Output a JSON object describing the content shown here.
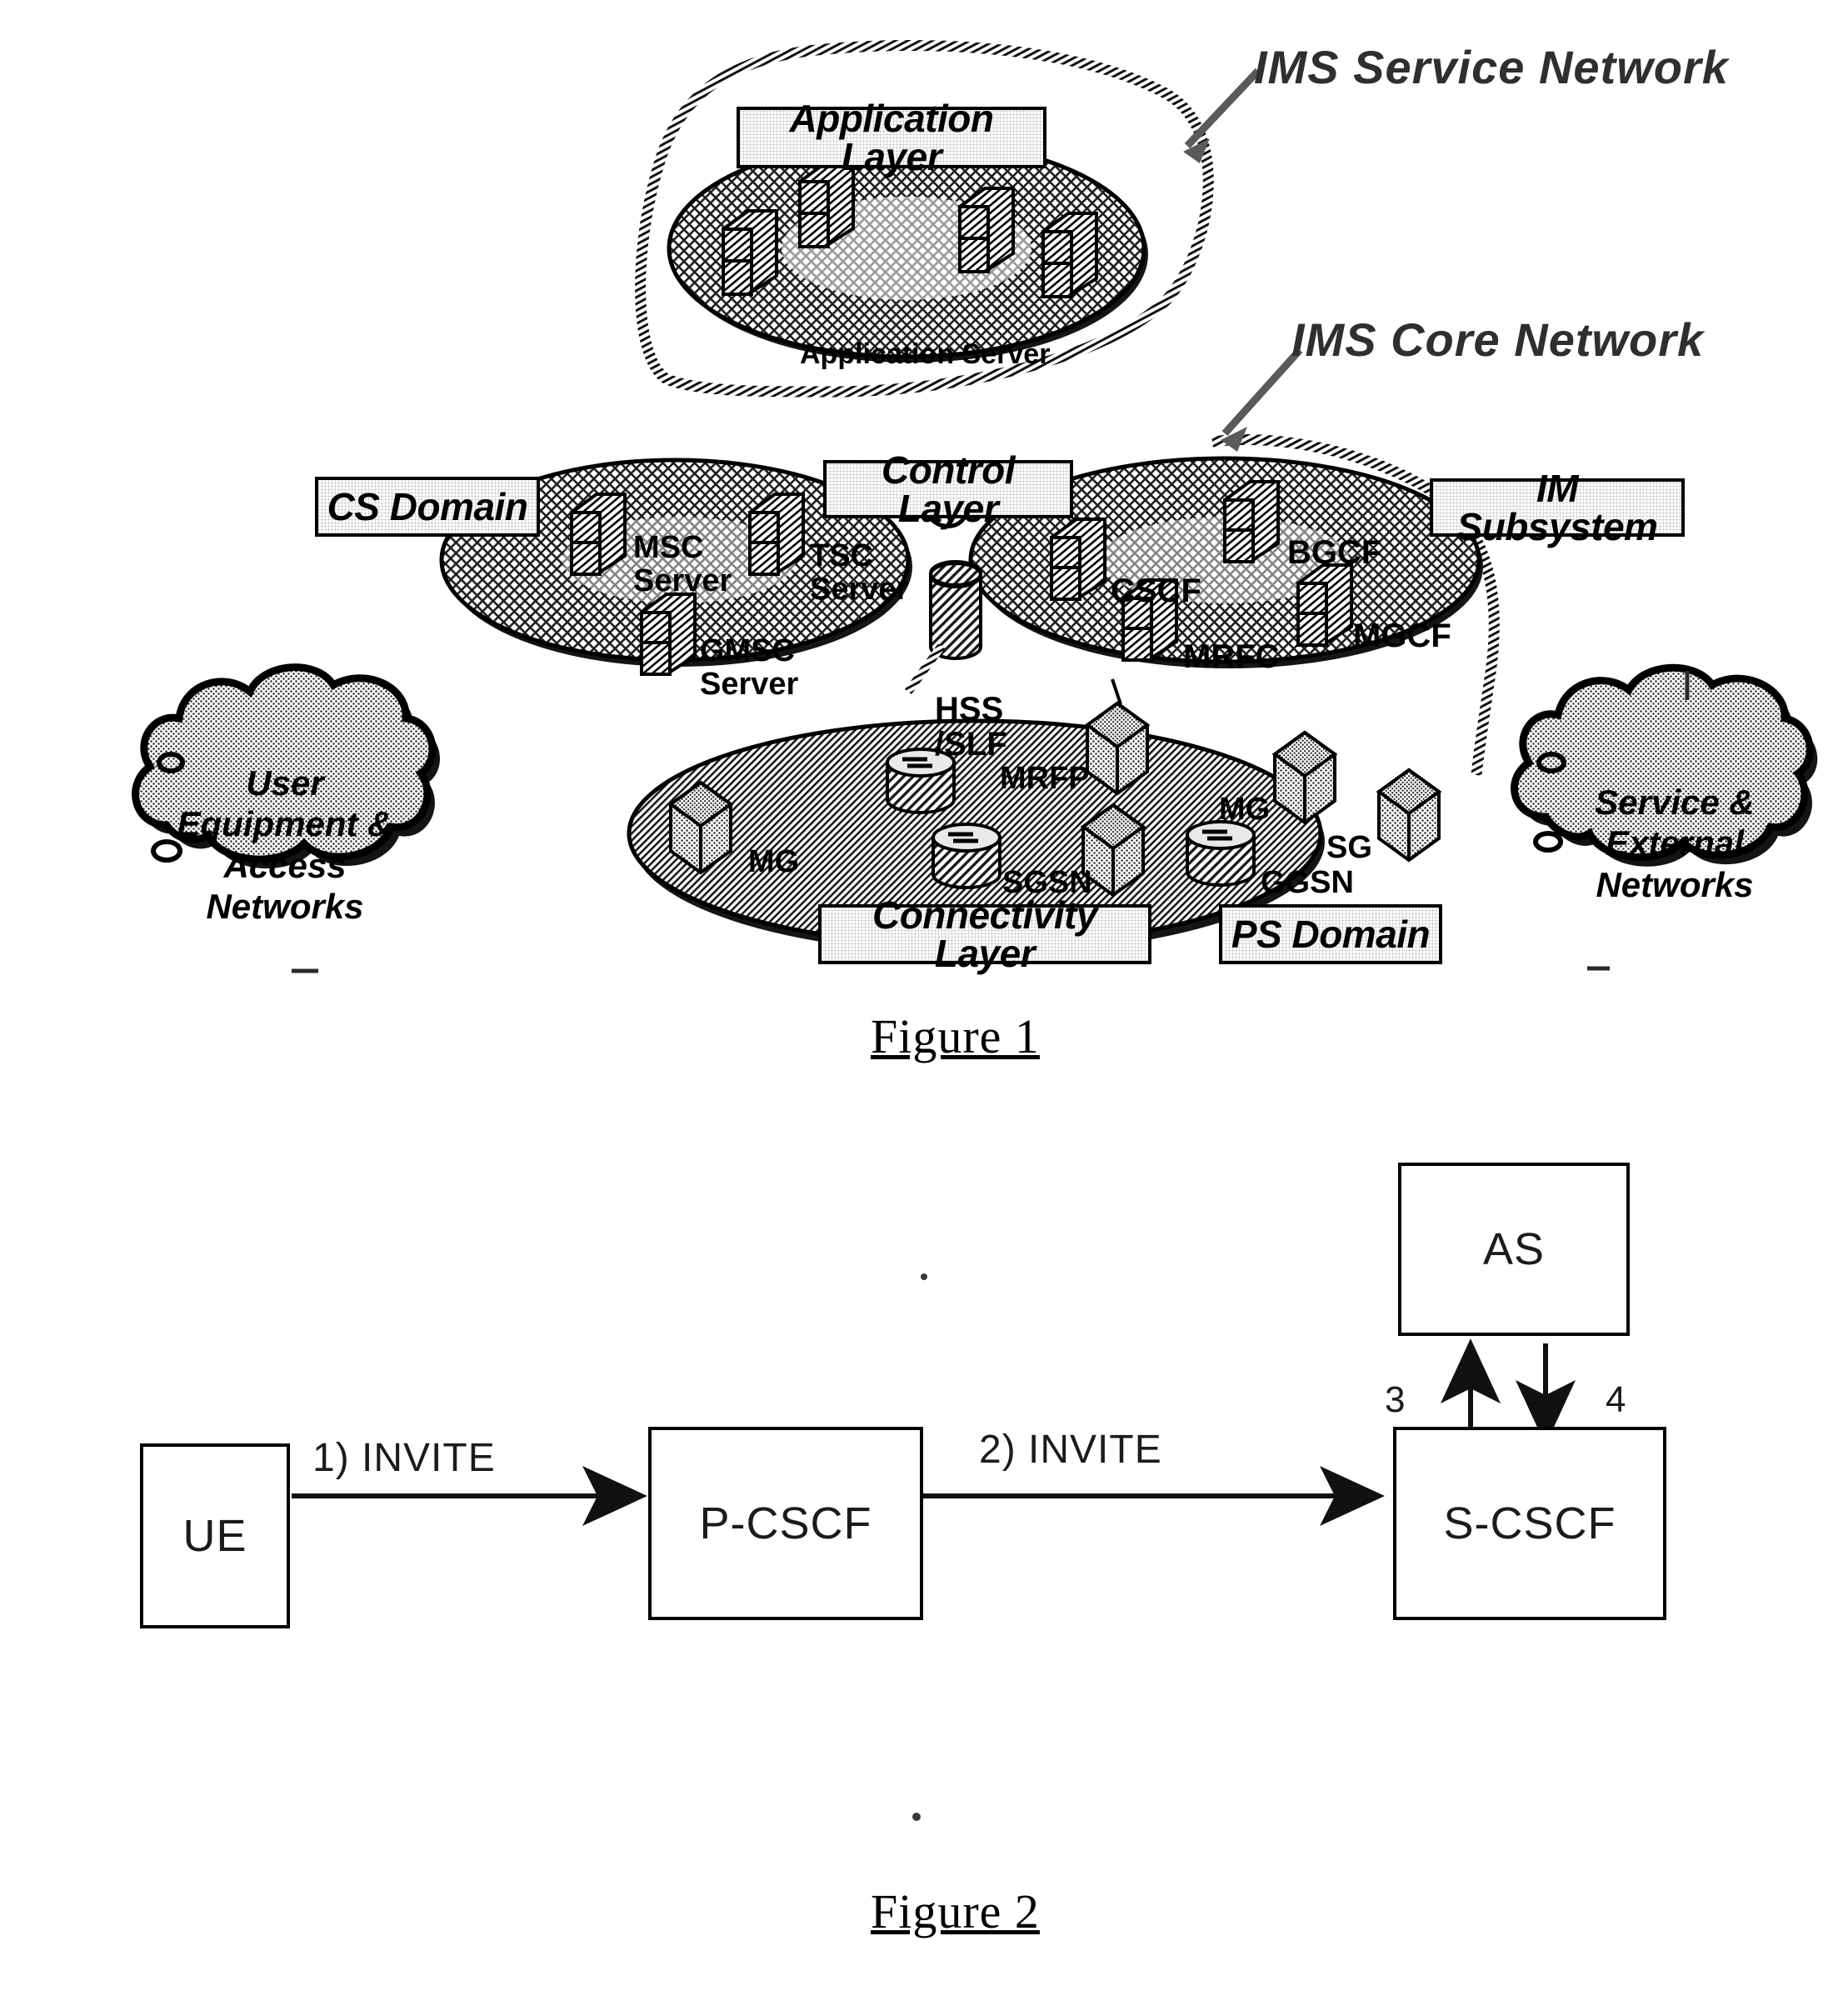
{
  "figure1": {
    "callouts": [
      {
        "id": "ims-service-network",
        "text": "IMS Service Network"
      },
      {
        "id": "ims-core-network",
        "text": "IMS Core Network"
      }
    ],
    "plates": [
      {
        "id": "application-layer",
        "text": "Application Layer"
      },
      {
        "id": "cs-domain",
        "text": "CS Domain"
      },
      {
        "id": "control-layer",
        "text": "Control Layer"
      },
      {
        "id": "im-subsystem",
        "text": "IM Subsystem"
      },
      {
        "id": "connectivity-layer",
        "text": "Connectivity Layer"
      },
      {
        "id": "ps-domain",
        "text": "PS Domain"
      }
    ],
    "application_layer": {
      "inner_label": "Application Server",
      "server_count": 4
    },
    "cs_domain_nodes": [
      {
        "id": "msc-server",
        "label": "MSC\nServer"
      },
      {
        "id": "tsc-server",
        "label": "TSC\nServer"
      },
      {
        "id": "gmsc-server",
        "label": "GMSC\nServer"
      }
    ],
    "im_subsystem_nodes": [
      {
        "id": "cscf",
        "label": "CSCF"
      },
      {
        "id": "bgcf",
        "label": "BGCF"
      },
      {
        "id": "mrfc",
        "label": "MRFC"
      },
      {
        "id": "mgcf",
        "label": "MGCF"
      }
    ],
    "hss_label": "HSS\n/SLF",
    "connectivity_nodes": [
      {
        "id": "mg-left",
        "label": "MG"
      },
      {
        "id": "mrfp",
        "label": "MRFP"
      },
      {
        "id": "sgsn",
        "label": "SGSN"
      },
      {
        "id": "mg-right",
        "label": "MG"
      },
      {
        "id": "sg",
        "label": "SG"
      },
      {
        "id": "ggsn",
        "label": "GGSN"
      }
    ],
    "clouds": [
      {
        "id": "user-equipment-access-networks",
        "label": "User\nEquipment &\nAccess\nNetworks"
      },
      {
        "id": "service-external-networks",
        "label": "Service &\nExternal\nNetworks"
      }
    ],
    "caption": "Figure 1"
  },
  "figure2": {
    "boxes": [
      {
        "id": "ue",
        "label": "UE"
      },
      {
        "id": "p-cscf",
        "label": "P-CSCF"
      },
      {
        "id": "s-cscf",
        "label": "S-CSCF"
      },
      {
        "id": "as",
        "label": "AS"
      }
    ],
    "flow_labels": [
      {
        "id": "step-1",
        "text": "1) INVITE"
      },
      {
        "id": "step-2",
        "text": "2) INVITE"
      }
    ],
    "step_numbers": [
      {
        "id": "step-3",
        "text": "3"
      },
      {
        "id": "step-4",
        "text": "4"
      }
    ],
    "caption": "Figure 2"
  },
  "colors": {
    "ink": "#000000",
    "soft_ink": "#2f2f2f",
    "fill_light": "#d9d9d9",
    "fill_mid": "#bdbdbd"
  }
}
